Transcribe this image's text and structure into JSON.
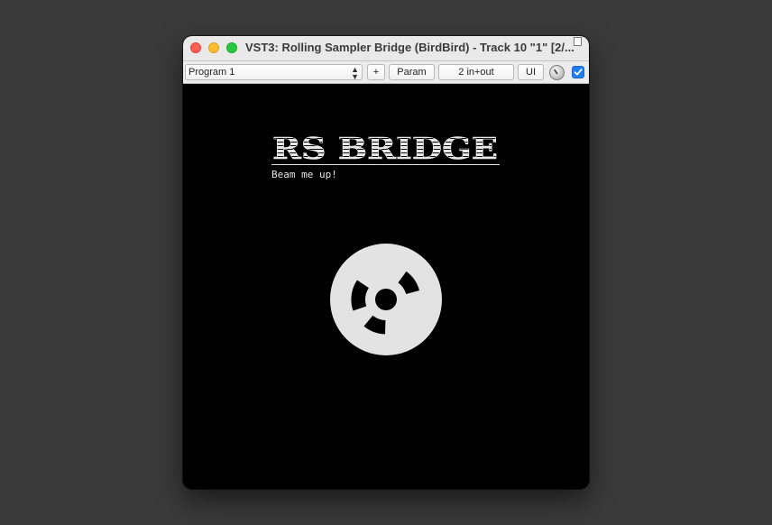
{
  "window": {
    "title": "VST3: Rolling Sampler Bridge (BirdBird) - Track 10 \"1\" [2/..."
  },
  "toolbar": {
    "program_value": "Program 1",
    "plus_label": "+",
    "param_label": "Param",
    "inout_label": "2 in+out",
    "ui_label": "UI",
    "bypass_checked": true
  },
  "plugin": {
    "logo_text": "RS BRIDGE",
    "tagline": "Beam me up!",
    "icon": "disc-reel-icon"
  },
  "colors": {
    "desktop": "#3a3a3a",
    "plugin_background": "#000000",
    "plugin_foreground": "#e3e3e3",
    "checkbox_accent": "#1f7ef6"
  }
}
